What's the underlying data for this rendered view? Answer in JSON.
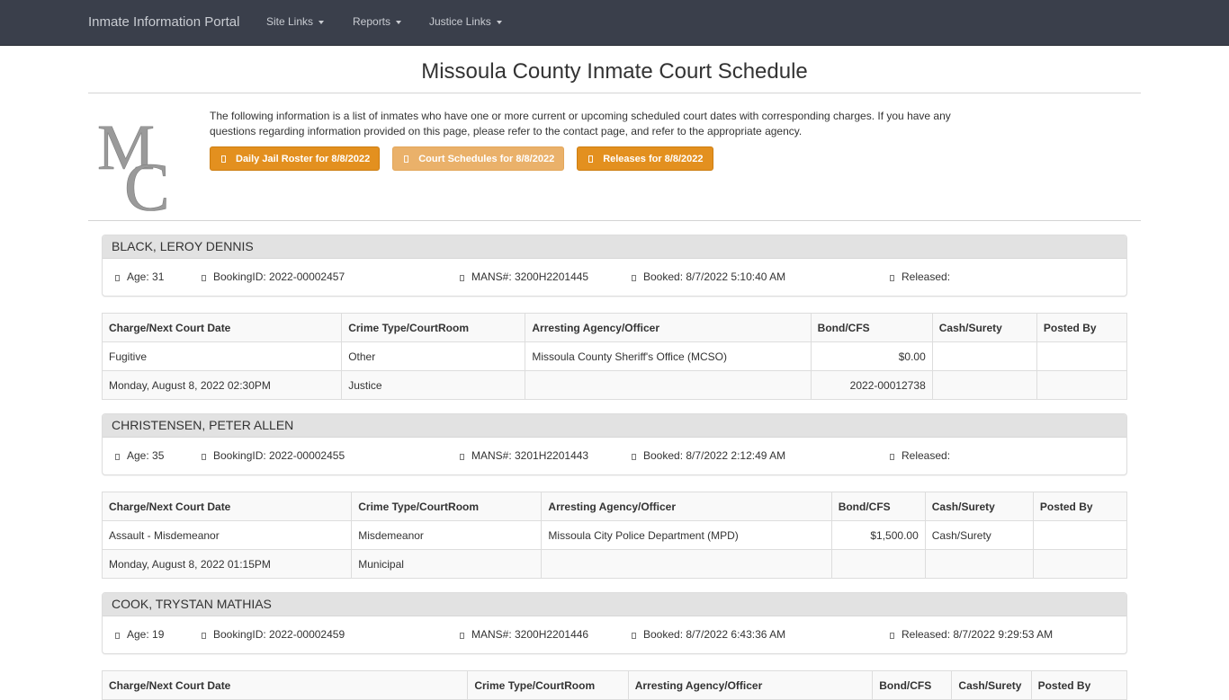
{
  "navbar": {
    "brand": "Inmate Information Portal",
    "items": [
      {
        "label": "Site Links"
      },
      {
        "label": "Reports"
      },
      {
        "label": "Justice Links"
      }
    ]
  },
  "page": {
    "title": "Missoula County Inmate Court Schedule",
    "logo_text": "MC",
    "intro": "The following information is a list of inmates who have one or more current or upcoming scheduled court dates with corresponding charges. If you have any questions regarding information provided on this page, please refer to the contact page, and refer to the appropriate agency.",
    "buttons": [
      {
        "label": "Daily Jail Roster for 8/8/2022",
        "icon": "list-icon",
        "active": false
      },
      {
        "label": "Court Schedules for 8/8/2022",
        "icon": "calendar-icon",
        "active": true
      },
      {
        "label": "Releases for 8/8/2022",
        "icon": "release-icon",
        "active": false
      }
    ],
    "accent_color": "#e3901f"
  },
  "table_headers": [
    "Charge/Next Court Date",
    "Crime Type/CourtRoom",
    "Arresting Agency/Officer",
    "Bond/CFS",
    "Cash/Surety",
    "Posted By"
  ],
  "inmates": [
    {
      "name": "BLACK, LEROY DENNIS",
      "age": "Age: 31",
      "booking_id": "BookingID: 2022-00002457",
      "mans": "MANS#: 3200H2201445",
      "booked": "Booked: 8/7/2022 5:10:40 AM",
      "released": "Released:",
      "rows": [
        [
          "Fugitive",
          "Other",
          "Missoula County Sheriff's Office (MCSO)",
          "$0.00",
          "",
          ""
        ],
        [
          "Monday, August 8, 2022 02:30PM",
          "Justice",
          "",
          "2022-00012738",
          "",
          ""
        ]
      ]
    },
    {
      "name": "CHRISTENSEN, PETER ALLEN",
      "age": "Age: 35",
      "booking_id": "BookingID: 2022-00002455",
      "mans": "MANS#: 3201H2201443",
      "booked": "Booked: 8/7/2022 2:12:49 AM",
      "released": "Released:",
      "rows": [
        [
          "Assault - Misdemeanor",
          "Misdemeanor",
          "Missoula City Police Department (MPD)",
          "$1,500.00",
          "Cash/Surety",
          ""
        ],
        [
          "Monday, August 8, 2022 01:15PM",
          "Municipal",
          "",
          "",
          "",
          ""
        ]
      ]
    },
    {
      "name": "COOK, TRYSTAN MATHIAS",
      "age": "Age: 19",
      "booking_id": "BookingID: 2022-00002459",
      "mans": "MANS#: 3200H2201446",
      "booked": "Booked: 8/7/2022 6:43:36 AM",
      "released": "Released: 8/7/2022 9:29:53 AM",
      "rows": []
    }
  ]
}
